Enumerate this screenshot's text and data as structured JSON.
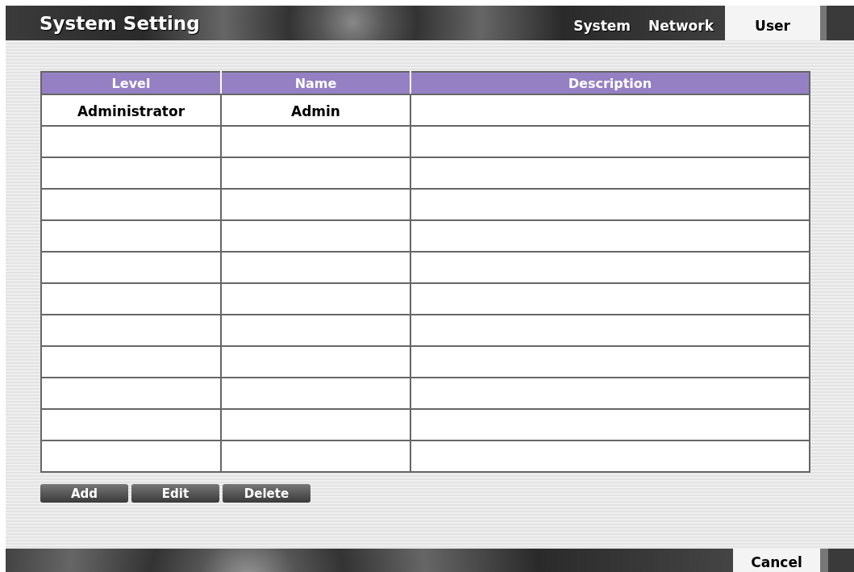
{
  "window": {
    "title": "System Setting"
  },
  "tabs": [
    {
      "label": "System",
      "selected": false
    },
    {
      "label": "Network",
      "selected": false
    },
    {
      "label": "User",
      "selected": true
    }
  ],
  "table": {
    "columns": [
      "Level",
      "Name",
      "Description"
    ],
    "rows": [
      {
        "level": "Administrator",
        "name": "Admin"
      },
      {},
      {},
      {},
      {},
      {},
      {},
      {},
      {},
      {},
      {},
      {}
    ]
  },
  "buttons": [
    "Add",
    "Edit",
    "Delete"
  ],
  "footer": {
    "cancel": "Cancel"
  }
}
